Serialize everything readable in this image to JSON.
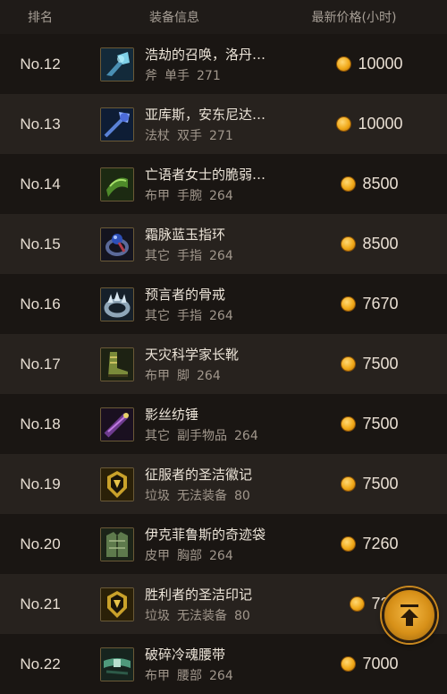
{
  "header": {
    "rank": "排名",
    "info": "装备信息",
    "price": "最新价格(小时)"
  },
  "rows": [
    {
      "rank": "No.12",
      "name": "浩劫的召唤，洛丹…",
      "type": "斧",
      "slot": "单手",
      "level": "271",
      "price": "10000",
      "icon": "axe-icon"
    },
    {
      "rank": "No.13",
      "name": "亚库斯，安东尼达…",
      "type": "法杖",
      "slot": "双手",
      "level": "271",
      "price": "10000",
      "icon": "staff-icon"
    },
    {
      "rank": "No.14",
      "name": "亡语者女士的脆弱…",
      "type": "布甲",
      "slot": "手腕",
      "level": "264",
      "price": "8500",
      "icon": "bracer-icon"
    },
    {
      "rank": "No.15",
      "name": "霜脉蓝玉指环",
      "type": "其它",
      "slot": "手指",
      "level": "264",
      "price": "8500",
      "icon": "ring-icon"
    },
    {
      "rank": "No.16",
      "name": "预言者的骨戒",
      "type": "其它",
      "slot": "手指",
      "level": "264",
      "price": "7670",
      "icon": "bone-ring-icon"
    },
    {
      "rank": "No.17",
      "name": "天灾科学家长靴",
      "type": "布甲",
      "slot": "脚",
      "level": "264",
      "price": "7500",
      "icon": "boots-icon"
    },
    {
      "rank": "No.18",
      "name": "影丝纺锤",
      "type": "其它",
      "slot": "副手物品",
      "level": "264",
      "price": "7500",
      "icon": "spindle-icon"
    },
    {
      "rank": "No.19",
      "name": "征服者的圣洁徽记",
      "type": "垃圾",
      "slot": "无法装备",
      "level": "80",
      "price": "7500",
      "icon": "helm-token-icon"
    },
    {
      "rank": "No.20",
      "name": "伊克菲鲁斯的奇迹袋",
      "type": "皮甲",
      "slot": "胸部",
      "level": "264",
      "price": "7260",
      "icon": "chest-icon"
    },
    {
      "rank": "No.21",
      "name": "胜利者的圣洁印记",
      "type": "垃圾",
      "slot": "无法装备",
      "level": "80",
      "price": "72",
      "icon": "helm-token-icon"
    },
    {
      "rank": "No.22",
      "name": "破碎冷魂腰带",
      "type": "布甲",
      "slot": "腰部",
      "level": "264",
      "price": "7000",
      "icon": "belt-icon"
    }
  ],
  "colors": {
    "coin": "#f0a91a",
    "row_alt": "#27221e",
    "row_base": "#1a1613",
    "icon_border": "#6b5a37"
  },
  "back_to_top": {
    "icon": "arrow-up-icon"
  }
}
